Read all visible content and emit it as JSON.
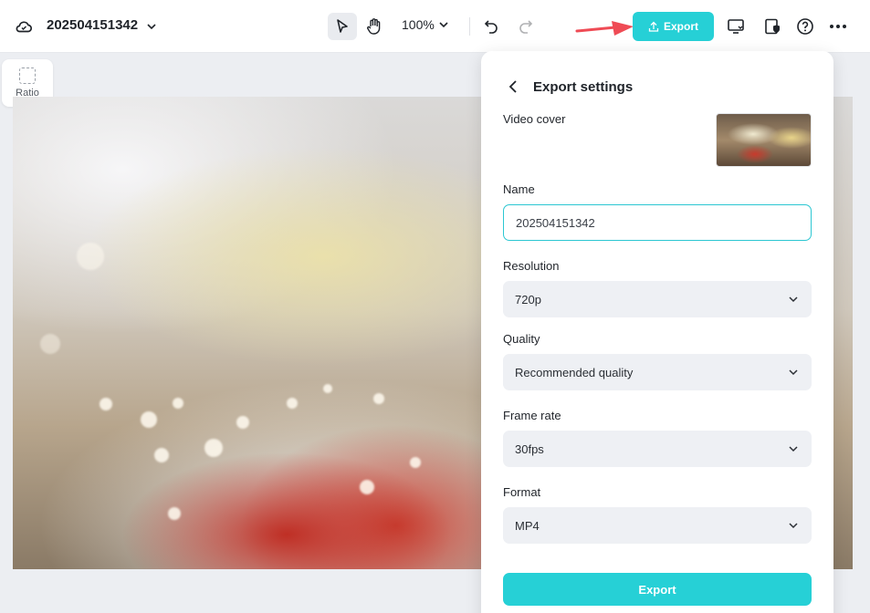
{
  "header": {
    "project_name": "202504151342",
    "zoom_level": "100%",
    "export_label": "Export"
  },
  "toolbar_left": {
    "ratio_label": "Ratio"
  },
  "export_panel": {
    "title": "Export settings",
    "video_cover_label": "Video cover",
    "name_label": "Name",
    "name_value": "202504151342",
    "resolution_label": "Resolution",
    "resolution_value": "720p",
    "quality_label": "Quality",
    "quality_value": "Recommended quality",
    "frame_rate_label": "Frame rate",
    "frame_rate_value": "30fps",
    "format_label": "Format",
    "format_value": "MP4",
    "export_button_label": "Export"
  },
  "colors": {
    "accent": "#26d0d6",
    "annotation_arrow": "#ef4b55"
  }
}
